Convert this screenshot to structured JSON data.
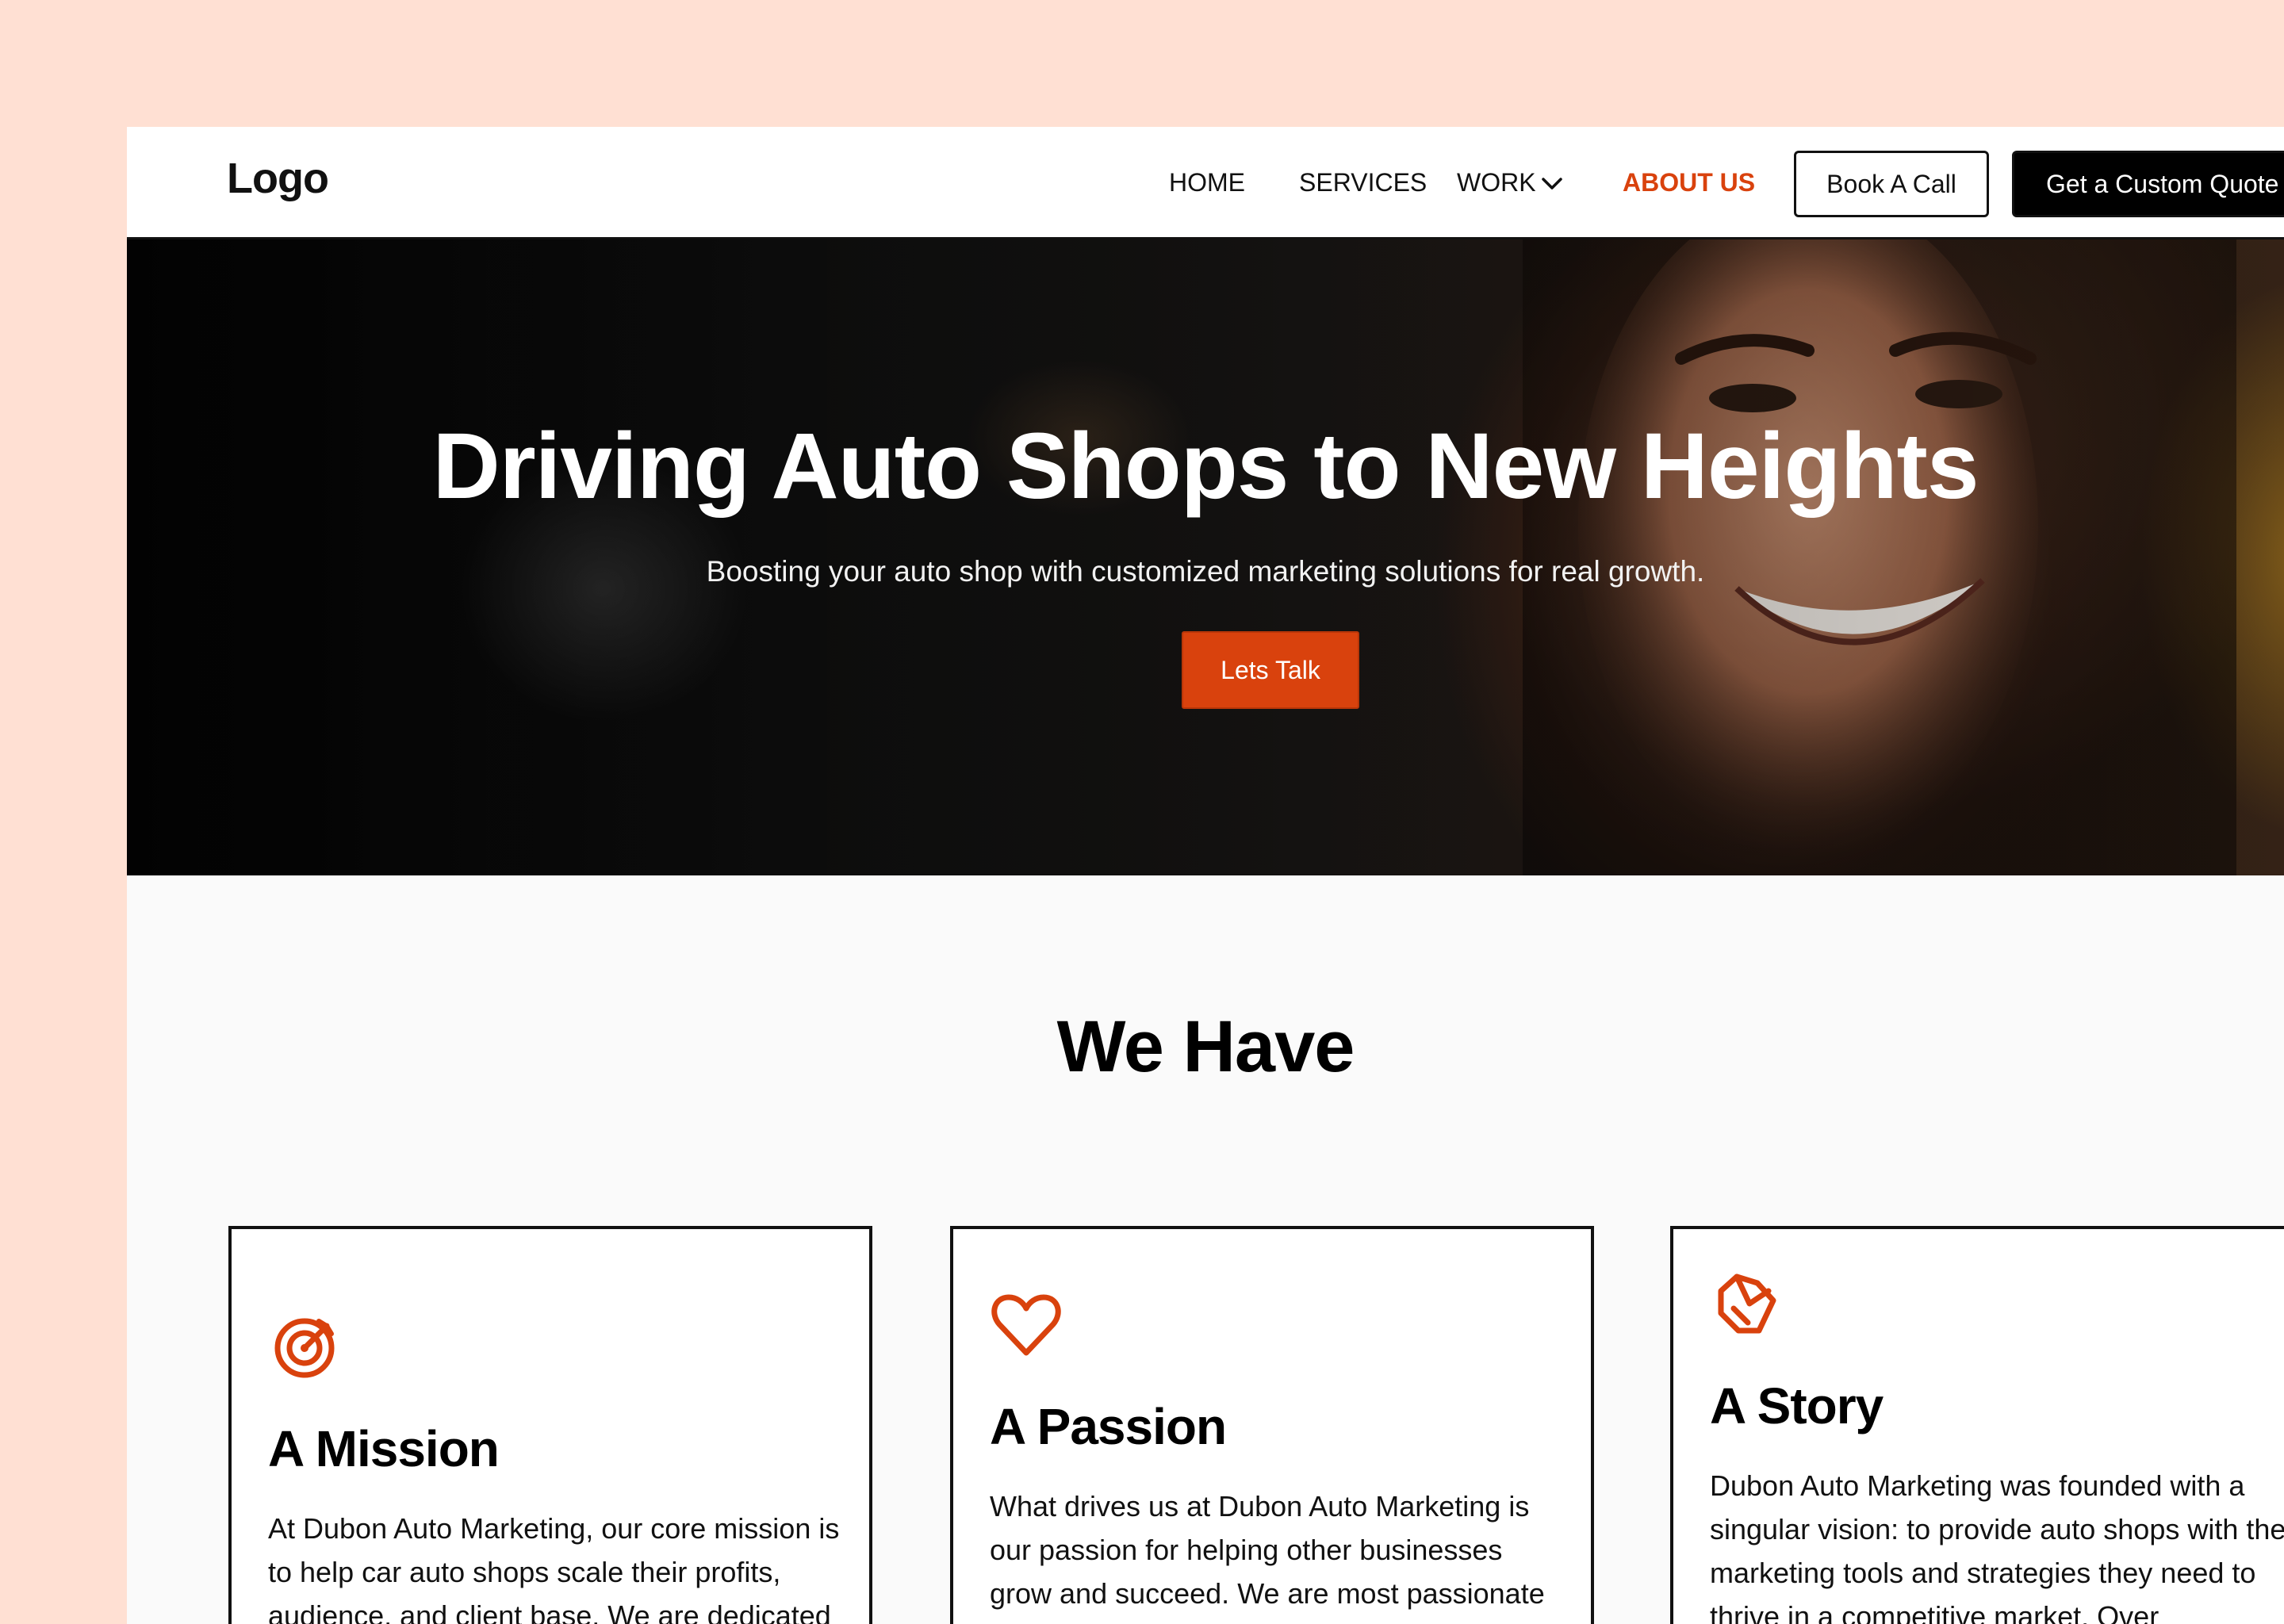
{
  "nav": {
    "logo": "Logo",
    "links": [
      "HOME",
      "SERVICES",
      "WORK",
      "ABOUT US"
    ],
    "book_button": "Book A Call",
    "quote_button": "Get a Custom Quote"
  },
  "hero": {
    "title": "Driving Auto Shops to New Heights",
    "subtitle": "Boosting your auto shop with customized marketing solutions for real growth.",
    "cta": "Lets Talk"
  },
  "section": {
    "title": "We Have",
    "cards": [
      {
        "icon": "target-icon",
        "title": "A Mission",
        "text": "At Dubon Auto Marketing, our core mission is to help car auto shops scale their profits, audience, and client base. We are dedicated"
      },
      {
        "icon": "heart-icon",
        "title": "A Passion",
        "text": "What drives us at Dubon Auto Marketing is our passion for helping other businesses grow and succeed. We are most passionate"
      },
      {
        "icon": "handshake-icon",
        "title": "A Story",
        "text": "Dubon Auto Marketing was founded with a singular vision: to provide auto shops with the marketing tools and strategies they need to thrive in a competitive market. Over"
      }
    ]
  },
  "colors": {
    "accent": "#D9420D",
    "page_background": "#FFE0D3"
  }
}
